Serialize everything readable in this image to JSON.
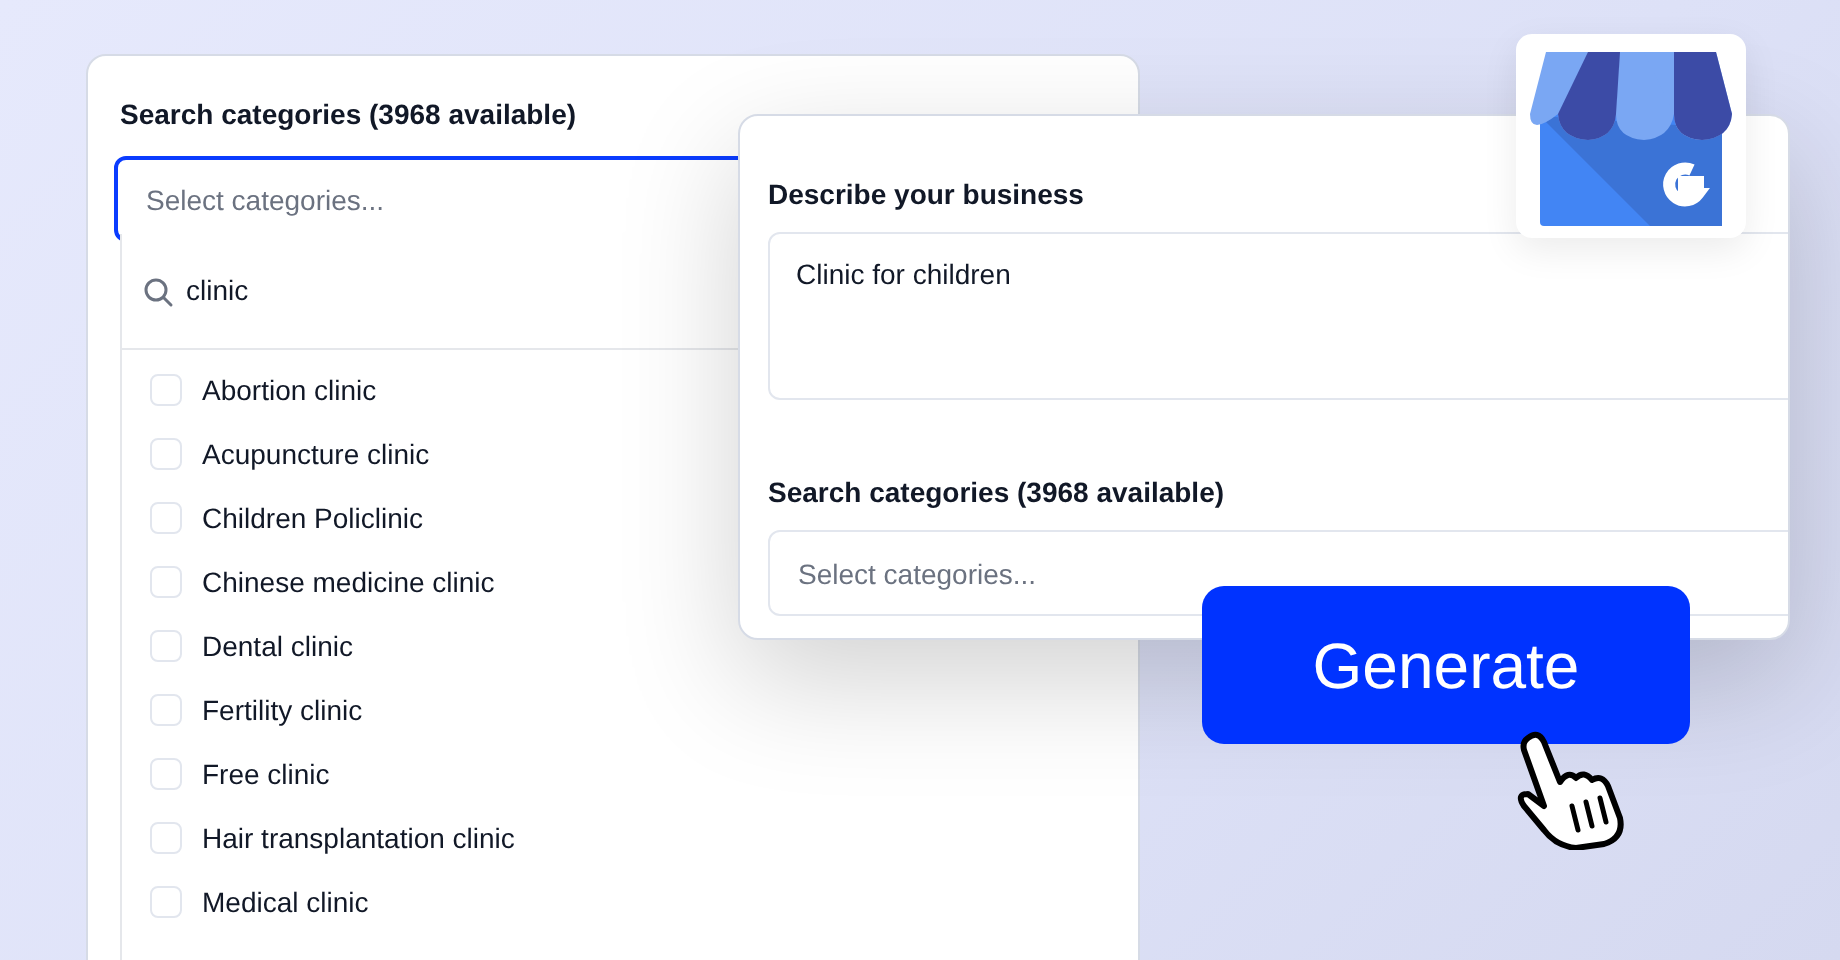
{
  "back_panel": {
    "label": "Search categories (3968 available)",
    "select": {
      "placeholder": "Select categories...",
      "focused": true
    },
    "search": {
      "value": "clinic"
    },
    "options": [
      {
        "label": "Abortion clinic",
        "checked": false
      },
      {
        "label": "Acupuncture clinic",
        "checked": false
      },
      {
        "label": "Children Policlinic",
        "checked": false
      },
      {
        "label": "Chinese medicine clinic",
        "checked": false
      },
      {
        "label": "Dental clinic",
        "checked": false
      },
      {
        "label": "Fertility clinic",
        "checked": false
      },
      {
        "label": "Free clinic",
        "checked": false
      },
      {
        "label": "Hair transplantation clinic",
        "checked": false
      },
      {
        "label": "Medical clinic",
        "checked": false
      }
    ]
  },
  "front_panel": {
    "description": {
      "label": "Describe your business",
      "value": "Clinic for children"
    },
    "categories": {
      "label": "Search categories (3968 available)",
      "placeholder": "Select categories..."
    }
  },
  "generate_button": {
    "label": "Generate"
  }
}
